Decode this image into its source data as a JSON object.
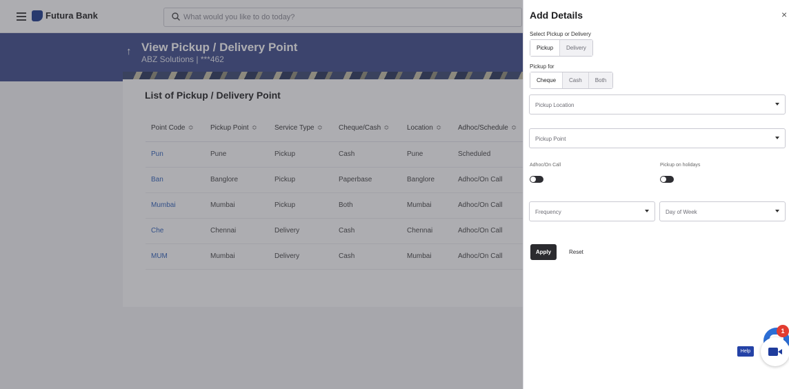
{
  "topbar": {
    "brand": "Futura Bank",
    "search_placeholder": "What would you like to do today?"
  },
  "page": {
    "title": "View Pickup / Delivery Point",
    "subtitle": "ABZ Solutions | ***462",
    "list_title": "List of Pickup / Delivery Point"
  },
  "table": {
    "headers": [
      "Point Code",
      "Pickup Point",
      "Service Type",
      "Cheque/Cash",
      "Location",
      "Adhoc/Schedule"
    ],
    "rows": [
      [
        "Pun",
        "Pune",
        "Pickup",
        "Cash",
        "Pune",
        "Scheduled"
      ],
      [
        "Ban",
        "Banglore",
        "Pickup",
        "Paperbase",
        "Banglore",
        "Adhoc/On Call"
      ],
      [
        "Mumbai",
        "Mumbai",
        "Pickup",
        "Both",
        "Mumbai",
        "Adhoc/On Call"
      ],
      [
        "Che",
        "Chennai",
        "Delivery",
        "Cash",
        "Chennai",
        "Adhoc/On Call"
      ],
      [
        "MUM",
        "Mumbai",
        "Delivery",
        "Cash",
        "Mumbai",
        "Adhoc/On Call"
      ]
    ]
  },
  "panel": {
    "title": "Add Details",
    "close": "×",
    "select_label": "Select Pickup or Delivery",
    "mode_options": [
      "Pickup",
      "Delivery"
    ],
    "mode_selected": "Pickup",
    "pickup_for_label": "Pickup for",
    "pickup_for_options": [
      "Cheque",
      "Cash",
      "Both"
    ],
    "pickup_for_selected": "Cheque",
    "pickup_location_placeholder": "Pickup Location",
    "pickup_point_placeholder": "Pickup Point",
    "adhoc_label": "Adhoc/On Call",
    "holidays_label": "Pickup on holidays",
    "frequency_placeholder": "Frequency",
    "day_of_week_placeholder": "Day of Week",
    "apply_label": "Apply",
    "reset_label": "Reset"
  },
  "widgets": {
    "chat_badge": "1",
    "help_label": "Help"
  },
  "colors": {
    "banner": "#3d4a8a",
    "link": "#2d5fb8",
    "primary_button": "#2b2b2f",
    "chat": "#2c6ed5",
    "badge": "#e23b30"
  },
  "icons": [
    "menu-icon",
    "bank-logo-icon",
    "search-icon",
    "back-arrow-icon",
    "sort-icon",
    "close-icon",
    "caret-down-icon",
    "chat-icon",
    "video-call-icon"
  ]
}
